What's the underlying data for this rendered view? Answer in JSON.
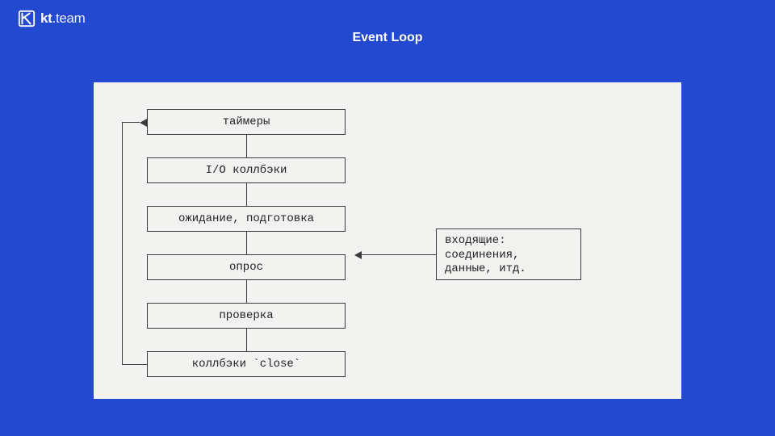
{
  "brand": {
    "name_bold": "kt",
    "name_light": ".team"
  },
  "title": "Event Loop",
  "stages": [
    "таймеры",
    "I/O коллбэки",
    "ожидание, подготовка",
    "опрос",
    "проверка",
    "коллбэки `close`"
  ],
  "side_box": {
    "line1": "входящие:",
    "line2": "соединения,",
    "line3": "данные, итд."
  }
}
